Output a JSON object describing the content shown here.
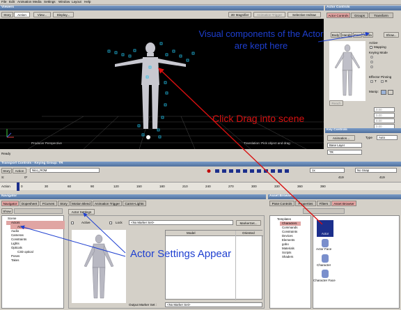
{
  "menu": [
    "File",
    "Edit",
    "Animation",
    "Media",
    "Settings",
    "Window",
    "Layout",
    "Help"
  ],
  "viewer": {
    "title": "Viewers",
    "story": "Story",
    "mode": "Action",
    "view": "View...",
    "display": "Display...",
    "magnifier": "2D Magnifier",
    "anim_trigger": "Animation Trigger",
    "selective": "Selective redraw",
    "camera": "Producer Perspective",
    "hint": "Translation: Pick object and drag",
    "status": "Ready"
  },
  "actor_controls": {
    "title": "Actor Controls",
    "tabs": [
      "Actor Controls",
      "Groups",
      "Transform"
    ],
    "body_tabs": [
      "Body",
      "Hands",
      "Feet",
      "Extra"
    ],
    "show": "Show...",
    "active": "Active",
    "mapping": "Mapping",
    "keying_mode": "Keying Mode",
    "effector_pinning": "Effector Pinning",
    "manip": "Manip:",
    "reach": "Reach",
    "t": "T",
    "r": "R",
    "values": [
      "0.00",
      "0.00",
      "0.00",
      "0.00"
    ]
  },
  "key_controls": {
    "title": "Key Controls",
    "animation": "Animation...",
    "type": "Type",
    "auto": "Auto",
    "base_layer": "Base Layer",
    "tr": "TR"
  },
  "transport": {
    "title": "Transport Controls - Keying Group: TR",
    "story": "Story",
    "action": "Action",
    "take": "Nico_ROM",
    "fps": "1x",
    "snap": "No Snap",
    "s_label": "S:",
    "s_val": "0*",
    "e_val": "419",
    "e2": "419",
    "ticks": [
      "0",
      "30",
      "60",
      "90",
      "120",
      "150",
      "180",
      "210",
      "240",
      "270",
      "300",
      "330",
      "360",
      "390"
    ]
  },
  "navigator": {
    "title": "Navigator",
    "tabs": [
      "Navigator",
      "Dopesheet",
      "FCurves",
      "Story",
      "Motion Blend",
      "Animation Trigger",
      "Cams+Lights"
    ],
    "show": "Show",
    "tree": [
      "Scene",
      "Actors",
      "Actor",
      "Audio",
      "Cameras",
      "Constraints",
      "Lights",
      "Opticals",
      "C3D optical",
      "Poses",
      "Takes"
    ],
    "settings_tab": "Actor Settings",
    "active": "Active",
    "lock": "Lock",
    "marker_set": "<No Marker Set>",
    "marker_set_btn": "MarkerSet...",
    "col_model": "Model",
    "col_oriented": "Oriented",
    "output_label": "Output Marker Set :",
    "output_val": "<No Marker Set>"
  },
  "asset": {
    "title": "Asset Browser",
    "tabs": [
      "Pose Controls",
      "Properties",
      "Filters",
      "Asset Browser"
    ],
    "tree": [
      "Templates",
      "Characters",
      "Commands",
      "Constraints",
      "Devices",
      "Elements",
      "gobo",
      "Materials",
      "Scripts",
      "Shaders"
    ],
    "items": [
      "Actor",
      "Actor Face",
      "Character",
      "Character Face"
    ]
  },
  "annotations": {
    "visual": "Visual components of the Actor are kept here",
    "drag": "Click Drag into scene",
    "settings": "Actor Settings Appear"
  }
}
